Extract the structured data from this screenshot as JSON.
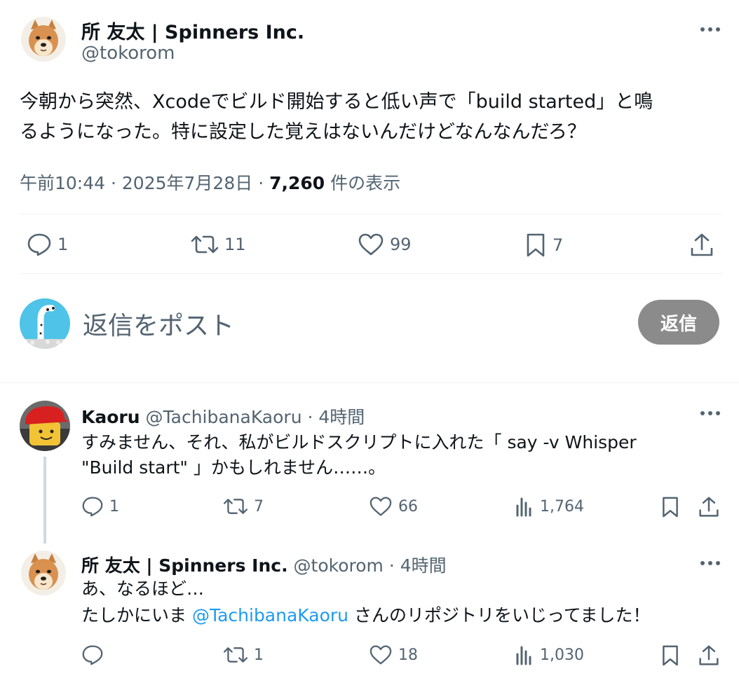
{
  "main_tweet": {
    "author_name": "所 友太 | Spinners Inc.",
    "author_handle": "@tokorom",
    "text_line1": "今朝から突然、Xcodeでビルド開始すると低い声で「build started」と鳴",
    "text_line2": "るようになった。特に設定した覚えはないんだけどなんなんだろ？",
    "time": "午前10:44",
    "date": "2025年7月28日",
    "separator": "·",
    "views_count": "7,260",
    "views_label": "件の表示",
    "replies": "1",
    "retweets": "11",
    "likes": "99",
    "bookmarks": "7"
  },
  "compose": {
    "placeholder": "返信をポスト",
    "button_label": "返信"
  },
  "replies": [
    {
      "author_name": "Kaoru",
      "author_handle": "@TachibanaKaoru",
      "separator": "·",
      "time": "4時間",
      "text_line1": "すみません、それ、私がビルドスクリプトに入れた「 say -v Whisper",
      "text_line2": "\"Build start\" 」かもしれません……。",
      "replies": "1",
      "retweets": "7",
      "likes": "66",
      "views": "1,764"
    },
    {
      "author_name": "所 友太 | Spinners Inc.",
      "author_handle": "@tokorom",
      "separator": "·",
      "time": "4時間",
      "text_line1": "あ、なるほど…",
      "text_line2_prefix": "たしかにいま ",
      "text_line2_mention": "@TachibanaKaoru",
      "text_line2_suffix": " さんのリポジトリをいじってました！",
      "retweets": "1",
      "likes": "18",
      "views": "1,030"
    }
  ],
  "colors": {
    "text": "#0f1419",
    "muted": "#536471",
    "link": "#1d9bf0",
    "reply_button": "#8b8b8b",
    "divider": "#eff3f4"
  }
}
